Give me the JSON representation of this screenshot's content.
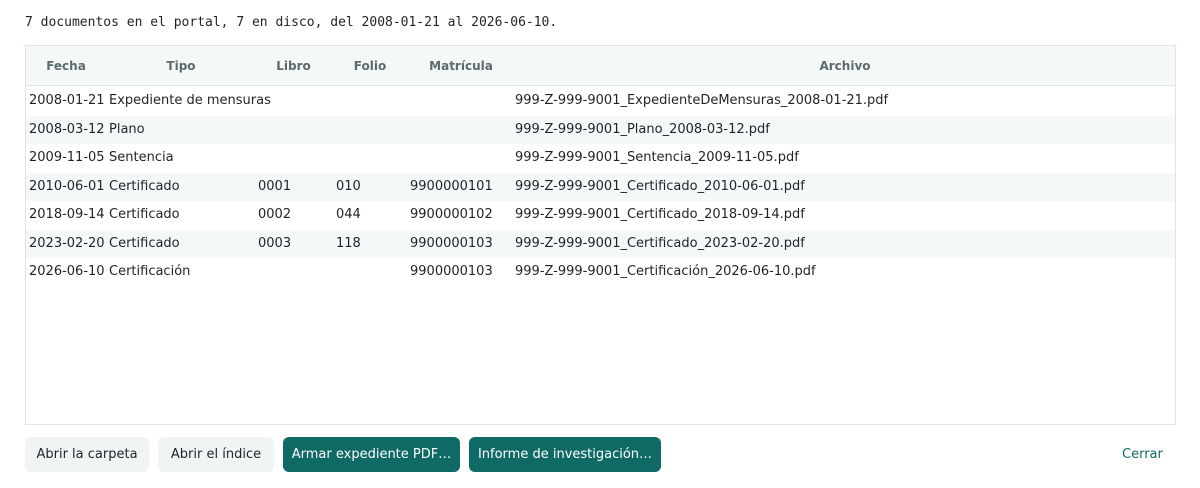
{
  "summary": "7 documentos en el portal, 7 en disco, del 2008-01-21 al 2026-06-10.",
  "table": {
    "columns": [
      "Fecha",
      "Tipo",
      "Libro",
      "Folio",
      "Matrícula",
      "Archivo"
    ],
    "rows": [
      {
        "fecha": "2008-01-21",
        "tipo": "Expediente de mensuras",
        "libro": "",
        "folio": "",
        "matricula": "",
        "archivo": "999-Z-999-9001_ExpedienteDeMensuras_2008-01-21.pdf"
      },
      {
        "fecha": "2008-03-12",
        "tipo": "Plano",
        "libro": "",
        "folio": "",
        "matricula": "",
        "archivo": "999-Z-999-9001_Plano_2008-03-12.pdf"
      },
      {
        "fecha": "2009-11-05",
        "tipo": "Sentencia",
        "libro": "",
        "folio": "",
        "matricula": "",
        "archivo": "999-Z-999-9001_Sentencia_2009-11-05.pdf"
      },
      {
        "fecha": "2010-06-01",
        "tipo": "Certificado",
        "libro": "0001",
        "folio": "010",
        "matricula": "9900000101",
        "archivo": "999-Z-999-9001_Certificado_2010-06-01.pdf"
      },
      {
        "fecha": "2018-09-14",
        "tipo": "Certificado",
        "libro": "0002",
        "folio": "044",
        "matricula": "9900000102",
        "archivo": "999-Z-999-9001_Certificado_2018-09-14.pdf"
      },
      {
        "fecha": "2023-02-20",
        "tipo": "Certificado",
        "libro": "0003",
        "folio": "118",
        "matricula": "9900000103",
        "archivo": "999-Z-999-9001_Certificado_2023-02-20.pdf"
      },
      {
        "fecha": "2026-06-10",
        "tipo": "Certificación",
        "libro": "",
        "folio": "",
        "matricula": "9900000103",
        "archivo": "999-Z-999-9001_Certificación_2026-06-10.pdf"
      }
    ]
  },
  "buttons": {
    "open_folder": "Abrir la carpeta",
    "open_index": "Abrir el índice",
    "build_pdf": "Armar expediente PDF…",
    "investigation_report": "Informe de investigación…",
    "close": "Cerrar"
  },
  "colors": {
    "primary": "#0f6a66",
    "header_bg": "#f4f8f8",
    "row_alt_bg": "#f5f8f8"
  }
}
